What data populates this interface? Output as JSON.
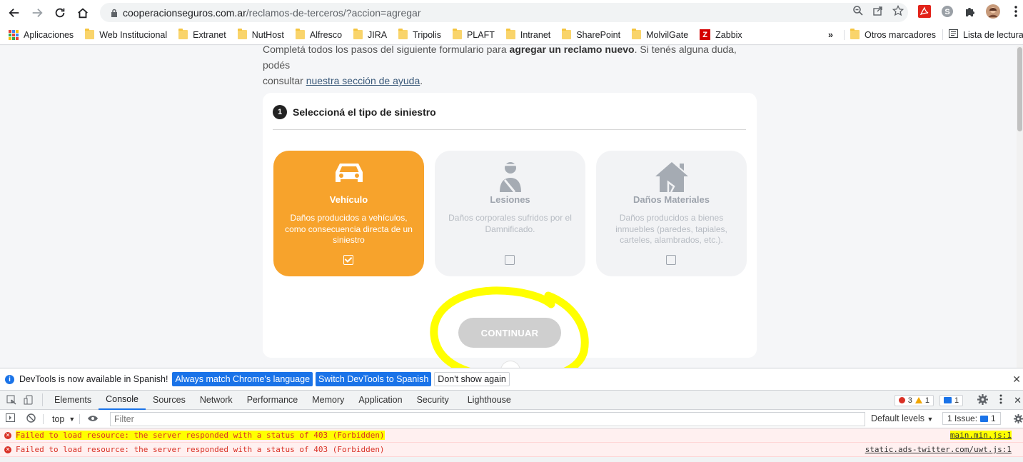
{
  "browser": {
    "url_domain": "cooperacionseguros.com.ar",
    "url_path": "/reclamos-de-terceros/?accion=agregar"
  },
  "bookmarks": [
    {
      "label": "Aplicaciones",
      "icon": "apps-grid-icon"
    },
    {
      "label": "Web Institucional",
      "icon": "folder-icon"
    },
    {
      "label": "Extranet",
      "icon": "folder-icon"
    },
    {
      "label": "NutHost",
      "icon": "folder-icon"
    },
    {
      "label": "Alfresco",
      "icon": "folder-icon"
    },
    {
      "label": "JIRA",
      "icon": "folder-icon"
    },
    {
      "label": "Tripolis",
      "icon": "folder-icon"
    },
    {
      "label": "PLAFT",
      "icon": "folder-icon"
    },
    {
      "label": "Intranet",
      "icon": "folder-icon"
    },
    {
      "label": "SharePoint",
      "icon": "folder-icon"
    },
    {
      "label": "MolvilGate",
      "icon": "folder-icon"
    },
    {
      "label": "Zabbix",
      "icon": "zabbix-icon"
    }
  ],
  "bookmarks_overflow": "»",
  "bookmarks_other": "Otros marcadores",
  "reading_list": "Lista de lectura",
  "page": {
    "intro_pre": "Completá todos los pasos del siguiente formulario para ",
    "intro_bold": "agregar un reclamo nuevo",
    "intro_post": ". Si tenés alguna duda, podés",
    "intro_line2": "consultar ",
    "intro_link": "nuestra sección de ayuda",
    "intro_end": ".",
    "step_number": "1",
    "step_title": "Seleccioná el tipo de siniestro",
    "options": [
      {
        "name": "Vehículo",
        "desc": "Daños producidos a vehículos, como consecuencia directa de un siniestro",
        "selected": true,
        "icon": "car-icon"
      },
      {
        "name": "Lesiones",
        "desc": "Daños corporales sufridos por el Damnificado.",
        "selected": false,
        "icon": "injured-person-icon"
      },
      {
        "name": "Daños Materiales",
        "desc": "Daños producidos a bienes inmuebles (paredes, tapiales, carteles, alambrados, etc.).",
        "selected": false,
        "icon": "damaged-house-icon"
      }
    ],
    "continue_label": "CONTINUAR"
  },
  "devtools": {
    "notice": "DevTools is now available in Spanish!",
    "btn_match": "Always match Chrome's language",
    "btn_switch": "Switch DevTools to Spanish",
    "btn_dont_show": "Don't show again",
    "tabs": [
      "Elements",
      "Console",
      "Sources",
      "Network",
      "Performance",
      "Memory",
      "Application",
      "Security",
      "Lighthouse"
    ],
    "active_tab": "Console",
    "error_count": "3",
    "warning_count": "1",
    "message_count": "1",
    "context": "top",
    "filter_placeholder": "Filter",
    "levels": "Default levels",
    "issues_label": "1 Issue:",
    "issues_count": "1",
    "messages": [
      {
        "text": "Failed to load resource: the server responded with a status of 403 (Forbidden)",
        "source": "main.min.js:1"
      },
      {
        "text": "Failed to load resource: the server responded with a status of 403 (Forbidden)",
        "source": "static.ads-twitter.com/uwt.js:1"
      }
    ]
  },
  "colors": {
    "accent_orange": "#f7a32c",
    "highlight_yellow": "#ffff00",
    "devtools_blue": "#1a73e8",
    "error_red": "#d93025"
  }
}
